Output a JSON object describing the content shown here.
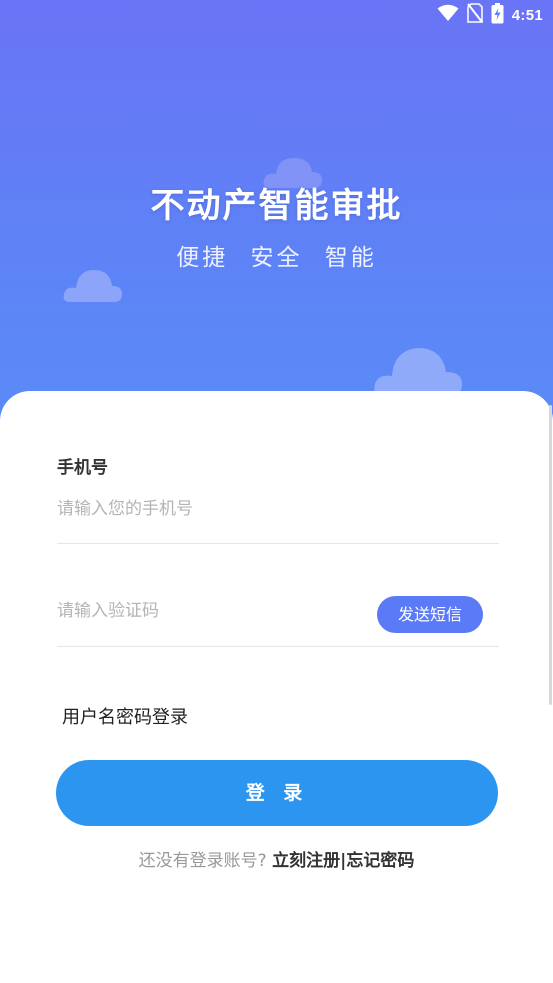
{
  "status_bar": {
    "time": "4:51",
    "icons": [
      "wifi-icon",
      "no-sim-icon",
      "battery-charging-icon"
    ]
  },
  "hero": {
    "title": "不动产智能审批",
    "subtitle": "便捷 安全 智能"
  },
  "form": {
    "phone_label": "手机号",
    "phone_placeholder": "请输入您的手机号",
    "code_placeholder": "请输入验证码",
    "sms_button": "发送短信",
    "alt_login": "用户名密码登录",
    "login_button": "登 录"
  },
  "footer": {
    "prompt": "还没有登录账号?",
    "register_link": "立刻注册",
    "separator": "|",
    "forgot_link": "忘记密码"
  },
  "colors": {
    "hero_top": "#6a74f6",
    "hero_bottom": "#5a8cf7",
    "sms_button": "#5a7af6",
    "login_button": "#2b95ef"
  }
}
